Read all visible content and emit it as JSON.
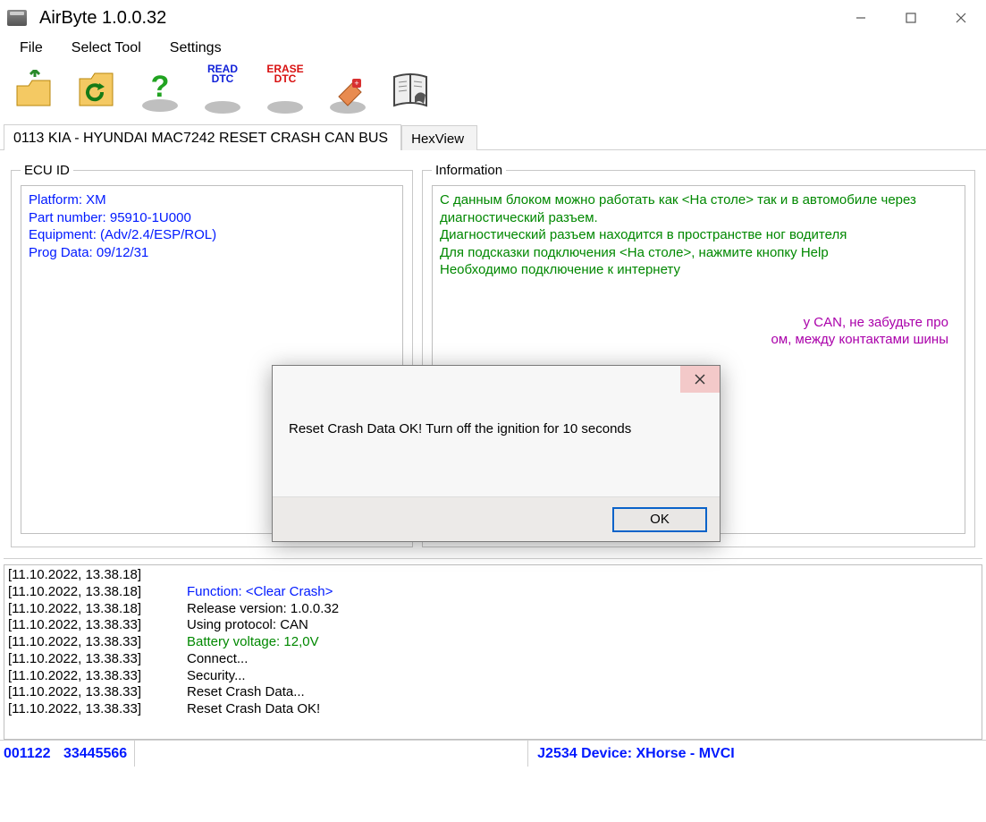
{
  "window": {
    "title": "AirByte  1.0.0.32"
  },
  "menu": {
    "file": "File",
    "select_tool": "Select Tool",
    "settings": "Settings"
  },
  "toolbar": {
    "read_dtc_top": "READ",
    "read_dtc_bot": "DTC",
    "erase_dtc_top": "ERASE",
    "erase_dtc_bot": "DTC"
  },
  "tabs": {
    "main": "0113 KIA - HYUNDAI MAC7242 RESET CRASH CAN BUS",
    "hexview": "HexView"
  },
  "panels": {
    "ecu_legend": "ECU ID",
    "info_legend": "Information"
  },
  "ecu": {
    "l1": "Platform: XM",
    "l2": "Part number: 95910-1U000",
    "l3": "Equipment: (Adv/2.4/ESP/ROL)",
    "l4": "Prog Data: 09/12/31"
  },
  "info": {
    "l1": "С данным блоком можно работать как <На столе> так и в автомобиле через диагностический разъем.",
    "l2": "Диагностический разъем находится в пространстве ног водителя",
    "l3": "Для подсказки подключения <На столе>, нажмите кнопку Help",
    "l4": "Необходимо подключение к интернету",
    "l5_tail": "у CAN, не забудьте про",
    "l6_tail": "ом, между контактами шины"
  },
  "log": [
    {
      "ts": "[11.10.2022, 13.38.18]",
      "msg": "",
      "cls": ""
    },
    {
      "ts": "[11.10.2022, 13.38.18]",
      "msg": "Function: <Clear Crash>",
      "cls": "blue"
    },
    {
      "ts": "[11.10.2022, 13.38.18]",
      "msg": "Release version: 1.0.0.32",
      "cls": ""
    },
    {
      "ts": "[11.10.2022, 13.38.33]",
      "msg": "Using protocol: CAN",
      "cls": ""
    },
    {
      "ts": "[11.10.2022, 13.38.33]",
      "msg": "Battery voltage: 12,0V",
      "cls": "green"
    },
    {
      "ts": "[11.10.2022, 13.38.33]",
      "msg": "Connect...",
      "cls": ""
    },
    {
      "ts": "[11.10.2022, 13.38.33]",
      "msg": "Security...",
      "cls": ""
    },
    {
      "ts": "[11.10.2022, 13.38.33]",
      "msg": "Reset Crash Data...",
      "cls": ""
    },
    {
      "ts": "[11.10.2022, 13.38.33]",
      "msg": "Reset Crash Data OK!",
      "cls": ""
    }
  ],
  "status": {
    "left1": "001122",
    "left2": "33445566",
    "right": "J2534 Device: XHorse - MVCI"
  },
  "dialog": {
    "message": "Reset Crash Data OK! Turn off the ignition for 10 seconds",
    "ok": "OK"
  }
}
